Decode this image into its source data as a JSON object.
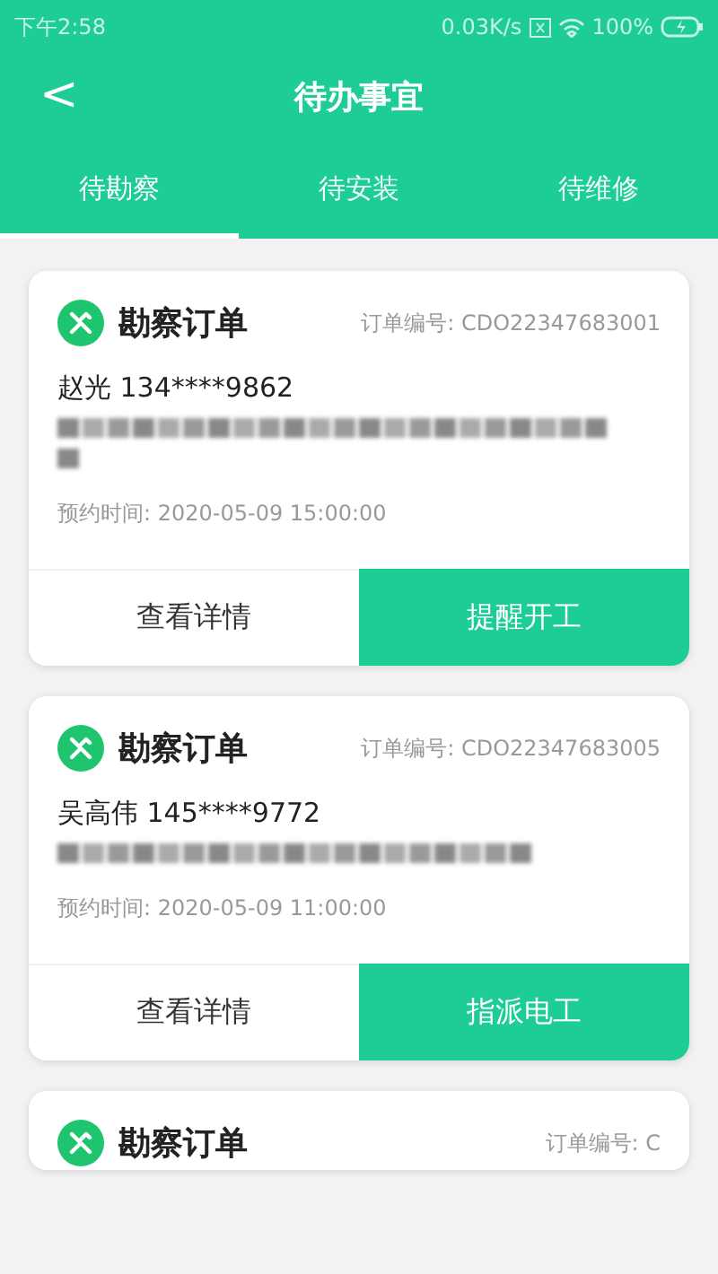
{
  "status_bar": {
    "time": "下午2:58",
    "speed": "0.03K/s",
    "battery": "100%"
  },
  "header": {
    "back": "<",
    "title": "待办事宜"
  },
  "tabs": [
    {
      "label": "待勘察",
      "selected": true
    },
    {
      "label": "待安装",
      "selected": false
    },
    {
      "label": "待维修",
      "selected": false
    }
  ],
  "orders": [
    {
      "title": "勘察订单",
      "number": "订单编号: CDO22347683001",
      "contact": "赵光 134****9862",
      "time": "预约时间: 2020-05-09 15:00:00",
      "actions": [
        "查看详情",
        "提醒开工"
      ]
    },
    {
      "title": "勘察订单",
      "number": "订单编号: CDO22347683005",
      "contact": "吴高伟 145****9772",
      "time": "预约时间: 2020-05-09 11:00:00",
      "actions": [
        "查看详情",
        "指派电工"
      ]
    },
    {
      "title": "勘察订单",
      "number": "订单编号: C"
    }
  ]
}
